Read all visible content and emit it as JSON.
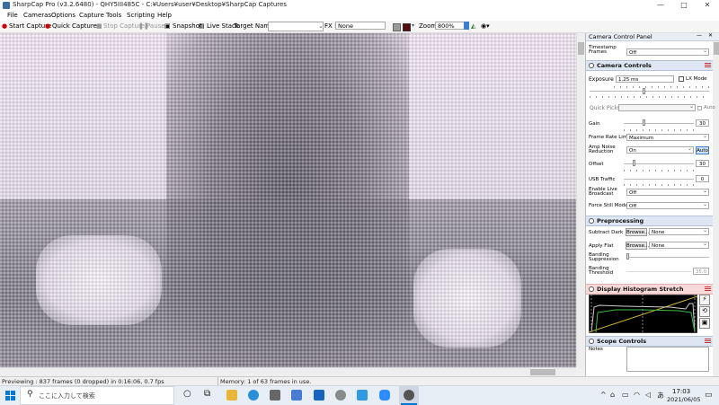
{
  "window": {
    "title": "SharpCap Pro (v3.2.6480) - QHY5III485C - C:¥Users¥user¥Desktop¥SharpCap Captures",
    "controls": [
      "—",
      "□",
      "✕"
    ]
  },
  "menu": [
    "File",
    "Cameras",
    "Options",
    "Capture",
    "Tools",
    "Scripting",
    "Help"
  ],
  "toolbar": {
    "start_capture": "Start Capture",
    "quick_capture": "Quick Capture",
    "stop_capture": "Stop Capture",
    "pause": "Pause",
    "snapshot": "Snapshot",
    "live_stack": "Live Stack",
    "target_name_label": "Target Name :",
    "fx_label": "FX :",
    "fx_value": "None",
    "zoom_label": "Zoom:",
    "zoom_value": "800%"
  },
  "panel": {
    "title": "Camera Control Panel",
    "timestamp_label": "Timestamp Frames",
    "timestamp_value": "Off",
    "camera_controls": {
      "title": "Camera Controls",
      "exposure_label": "Exposure",
      "exposure_value": "1.25 ms",
      "lx_mode": "LX Mode",
      "quick_picks": "Quick Picks",
      "auto": "Auto",
      "gain_label": "Gain",
      "gain_value": "30",
      "frame_rate_label": "Frame Rate Limit",
      "frame_rate_value": "Maximum",
      "amp_noise_label": "Amp Noise Reduction",
      "amp_noise_value": "On",
      "amp_auto": "Auto",
      "offset_label": "Offset",
      "offset_value": "30",
      "usb_label": "USB Traffic",
      "usb_value": "0",
      "live_broadcast_label": "Enable Live Broadcast",
      "live_broadcast_value": "Off",
      "force_still_label": "Force Still Mode",
      "force_still_value": "Off"
    },
    "preprocessing": {
      "title": "Preprocessing",
      "subtract_dark_label": "Subtract Dark",
      "flat_label": "Apply Flat",
      "browse": "Browse...",
      "subtract_dark_value": "None",
      "flat_value": "None",
      "banding_supp_label": "Banding Suppression",
      "banding_supp_value": "0",
      "banding_thresh_label": "Banding Threshold",
      "banding_thresh_value": "35.0"
    },
    "histogram": {
      "title": "Display Histogram Stretch"
    },
    "scope": {
      "title": "Scope Controls",
      "notes_label": "Notes"
    }
  },
  "status": {
    "left": "Previewing : 837 frames (0 dropped) in 0:16:06, 0.7 fps",
    "right": "Memory: 1 of 63 frames in use."
  },
  "taskbar": {
    "search": "ここに入力して検索",
    "time": "17:03",
    "date": "2021/06/05"
  },
  "colors": {
    "accent": "#0078d7",
    "panel_header": "#dde6f2",
    "histogram_header": "#f8d9d9"
  }
}
